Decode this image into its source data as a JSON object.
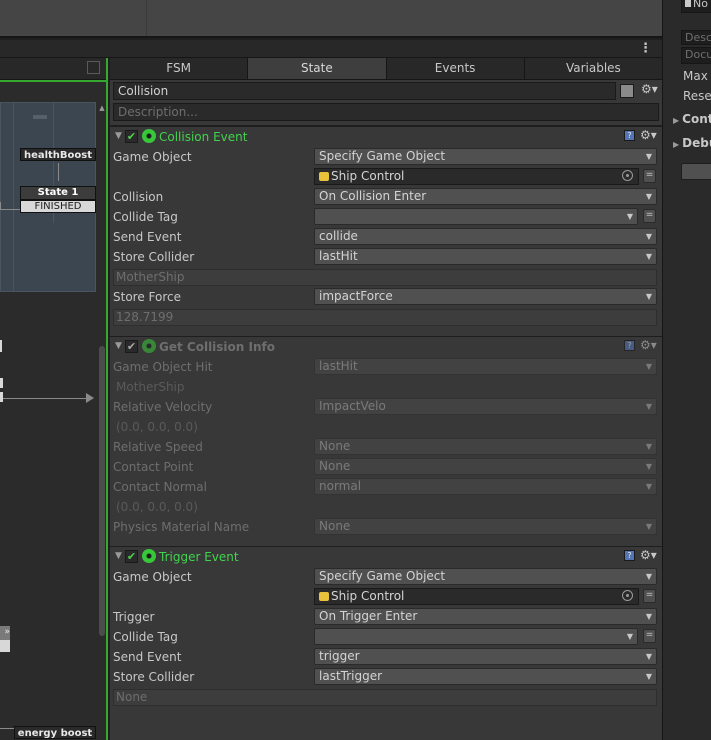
{
  "right_strip": {
    "rows": [
      "No",
      "Desc",
      "Docu",
      "Max I",
      "Rese",
      "Cont",
      "Debu"
    ]
  },
  "tabs": [
    {
      "label": "FSM"
    },
    {
      "label": "State"
    },
    {
      "label": "Events"
    },
    {
      "label": "Variables"
    }
  ],
  "graph": {
    "health_boost": "healthBoost",
    "state1": "State 1",
    "finished": "FINISHED",
    "energy_boost": "energy boost",
    "mini_label": "»"
  },
  "state": {
    "name": "Collision",
    "description_placeholder": "Description..."
  },
  "actions": {
    "collision_event": {
      "title": "Collision Event",
      "game_object_label": "Game Object",
      "game_object_value": "Specify Game Object",
      "object_ref": "Ship Control",
      "collision_label": "Collision",
      "collision_value": "On Collision Enter",
      "collide_tag_label": "Collide Tag",
      "collide_tag_value": "",
      "send_event_label": "Send Event",
      "send_event_value": "collide",
      "store_collider_label": "Store Collider",
      "store_collider_value": "lastHit",
      "store_collider_sub": "MotherShip",
      "store_force_label": "Store Force",
      "store_force_value": "impactForce",
      "store_force_sub": "128.7199"
    },
    "get_collision_info": {
      "title": "Get Collision Info",
      "game_object_hit_label": "Game Object Hit",
      "game_object_hit_value": "lastHit",
      "game_object_hit_sub": "MotherShip",
      "relative_velocity_label": "Relative Velocity",
      "relative_velocity_value": "ImpactVelo",
      "relative_velocity_sub": "(0.0, 0.0, 0.0)",
      "relative_speed_label": "Relative Speed",
      "relative_speed_value": "None",
      "contact_point_label": "Contact Point",
      "contact_point_value": "None",
      "contact_normal_label": "Contact Normal",
      "contact_normal_value": "normal",
      "contact_normal_sub": "(0.0, 0.0, 0.0)",
      "physics_material_label": "Physics Material Name",
      "physics_material_value": "None"
    },
    "trigger_event": {
      "title": "Trigger Event",
      "game_object_label": "Game Object",
      "game_object_value": "Specify Game Object",
      "object_ref": "Ship Control",
      "trigger_label": "Trigger",
      "trigger_value": "On Trigger Enter",
      "collide_tag_label": "Collide Tag",
      "collide_tag_value": "",
      "send_event_label": "Send Event",
      "send_event_value": "trigger",
      "store_collider_label": "Store Collider",
      "store_collider_value": "lastTrigger",
      "store_collider_sub": "None"
    }
  },
  "colors": {
    "accent_green": "#41d34d",
    "panel_bg": "#383838",
    "field_bg": "#505050"
  }
}
